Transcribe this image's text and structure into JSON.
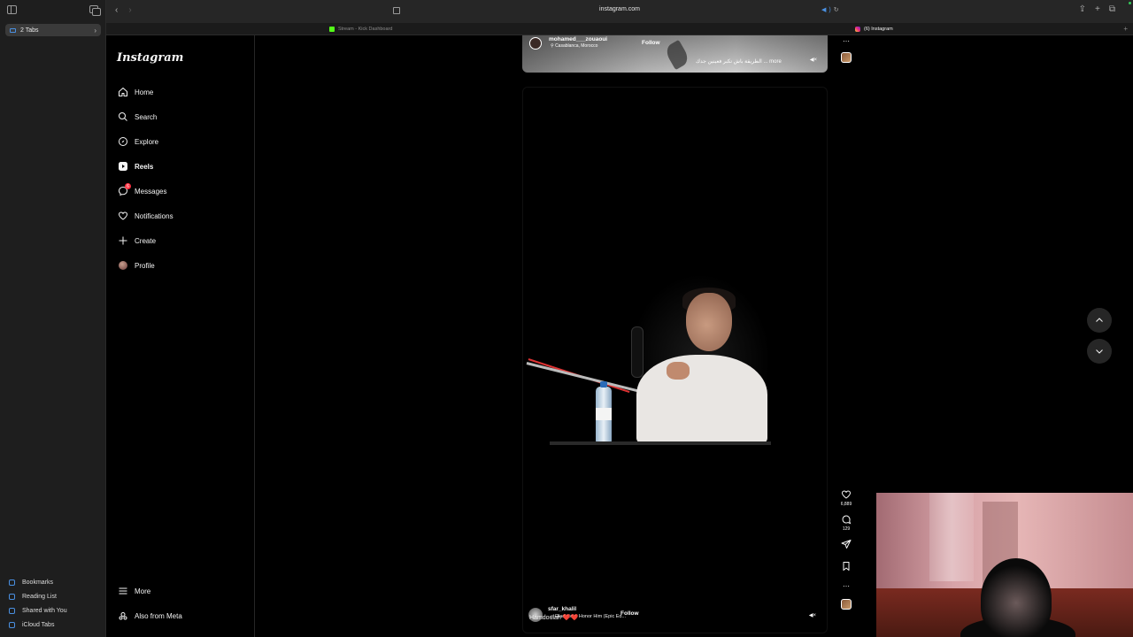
{
  "safari": {
    "tab_group_label": "2 Tabs",
    "url": "instagram.com",
    "tabs": [
      {
        "label": "Stream - Kick Dashboard"
      },
      {
        "label": "(6) Instagram"
      }
    ],
    "sidebar_bottom": [
      {
        "label": "Bookmarks"
      },
      {
        "label": "Reading List"
      },
      {
        "label": "Shared with You"
      },
      {
        "label": "iCloud Tabs"
      }
    ]
  },
  "instagram": {
    "logo": "Instagram",
    "nav": [
      {
        "label": "Home",
        "icon": "home-icon"
      },
      {
        "label": "Search",
        "icon": "search-icon"
      },
      {
        "label": "Explore",
        "icon": "compass-icon"
      },
      {
        "label": "Reels",
        "icon": "reels-icon",
        "active": true
      },
      {
        "label": "Messages",
        "icon": "messenger-icon",
        "badge": "6"
      },
      {
        "label": "Notifications",
        "icon": "heart-icon"
      },
      {
        "label": "Create",
        "icon": "plus-icon"
      },
      {
        "label": "Profile",
        "icon": "avatar"
      }
    ],
    "nav_bottom": [
      {
        "label": "More",
        "icon": "menu-icon"
      },
      {
        "label": "Also from Meta",
        "icon": "meta-icon"
      }
    ]
  },
  "reel_top": {
    "username": "mohamed___zouaoui",
    "location": "Casablanca, Morocco",
    "follow_label": "Follow",
    "caption": "الطريقة باش تكبر فعينين جدك ... more"
  },
  "reel_main": {
    "username": "sfar_khalil",
    "music": "Gladiator - Honor Him (Epic Ed...",
    "follow_label": "Follow",
    "caption": "Hamdoulah",
    "caption_emoji": "❤️❤️",
    "likes": "6,889",
    "comments": "129"
  },
  "colors": {
    "background": "#000000",
    "badge": "#ff3040",
    "accent": "#4a90e2"
  }
}
